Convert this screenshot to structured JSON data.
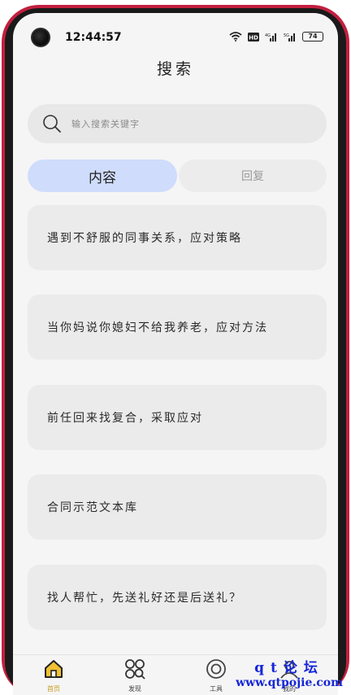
{
  "status_bar": {
    "time": "12:44:57",
    "battery": "74"
  },
  "header": {
    "title": "搜索"
  },
  "search": {
    "placeholder": "输入搜索关键字"
  },
  "tabs": [
    {
      "label": "内容",
      "active": true
    },
    {
      "label": "回复",
      "active": false
    }
  ],
  "results": [
    {
      "text": "遇到不舒服的同事关系，应对策略"
    },
    {
      "text": "当你妈说你媳妇不给我养老，应对方法"
    },
    {
      "text": "前任回来找复合，采取应对"
    },
    {
      "text": "合同示范文本库"
    },
    {
      "text": "找人帮忙，先送礼好还是后送礼？"
    }
  ],
  "bottom_nav": {
    "items": [
      {
        "label": "首页",
        "icon": "home-icon",
        "active": true
      },
      {
        "label": "发现",
        "icon": "grid-icon",
        "active": false
      },
      {
        "label": "工具",
        "icon": "tool-icon",
        "active": false
      },
      {
        "label": "我的",
        "icon": "profile-icon",
        "active": false
      }
    ]
  },
  "watermark": {
    "line1": "qt论坛",
    "line2": "www.qtpojie.com"
  },
  "colors": {
    "frame": "#c21f3f",
    "active_tab": "#cfdcfb",
    "home_active": "#e8b21e",
    "watermark": "#1626d8"
  }
}
